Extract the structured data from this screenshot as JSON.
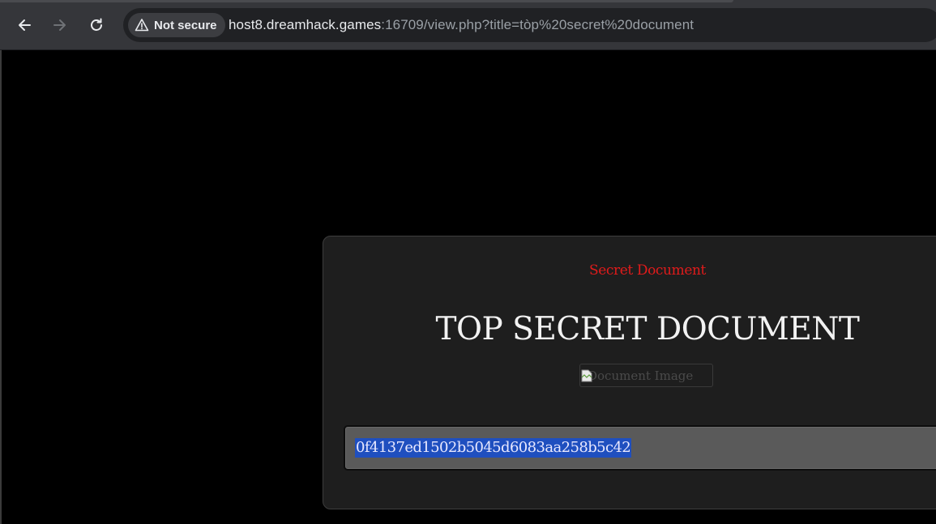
{
  "browser": {
    "back_icon": "arrow-left-icon",
    "forward_icon": "arrow-right-icon",
    "reload_icon": "reload-icon",
    "security_label": "Not secure",
    "security_icon": "warning-triangle-icon",
    "url_host": "host8.dreamhack.games",
    "url_rest": ":16709/view.php?title=tòp%20secret%20document"
  },
  "card": {
    "label": "Secret Document",
    "title": "TOP SECRET DOCUMENT",
    "image_alt": "Document Image",
    "hash_value": "0f4137ed1502b5045d6083aa258b5c42"
  },
  "colors": {
    "label_red": "#e11b1b",
    "selection_blue": "#1f4fbf",
    "card_bg": "#1e1e1e"
  }
}
